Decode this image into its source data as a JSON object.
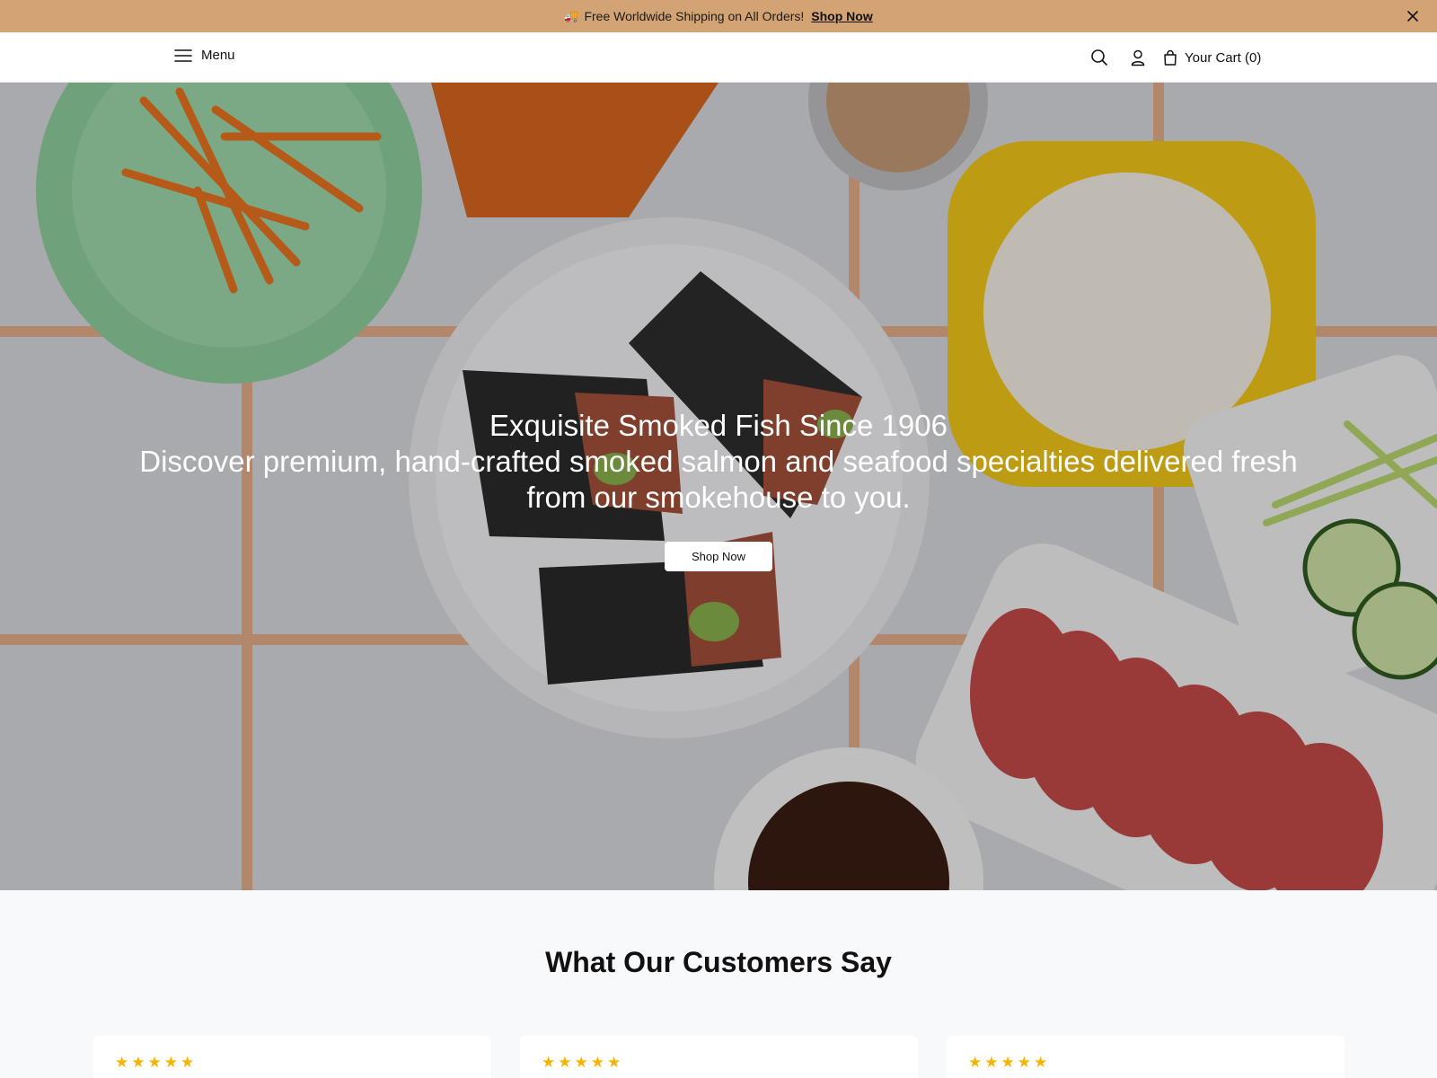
{
  "announcement": {
    "text": "Free Worldwide Shipping on All Orders!",
    "link": "Shop Now",
    "truck_emoji": "🚚",
    "background": "#d4a373"
  },
  "header": {
    "menu_label": "Menu",
    "cart_label": "Your Cart (0)"
  },
  "hero": {
    "title": "Exquisite Smoked Fish Since 1906",
    "subtitle": "Discover premium, hand-crafted smoked salmon and seafood specialties delivered fresh from our smokehouse to you.",
    "button": "Shop Now"
  },
  "testimonials": {
    "heading": "What Our Customers Say",
    "cards": [
      {
        "stars": "★★★★★"
      },
      {
        "stars": "★★★★★"
      },
      {
        "stars": "★★★★★"
      }
    ]
  },
  "icons": [
    "truck-icon",
    "close-icon",
    "hamburger-icon",
    "search-icon",
    "user-icon",
    "shopping-bag-icon",
    "star-icon"
  ]
}
